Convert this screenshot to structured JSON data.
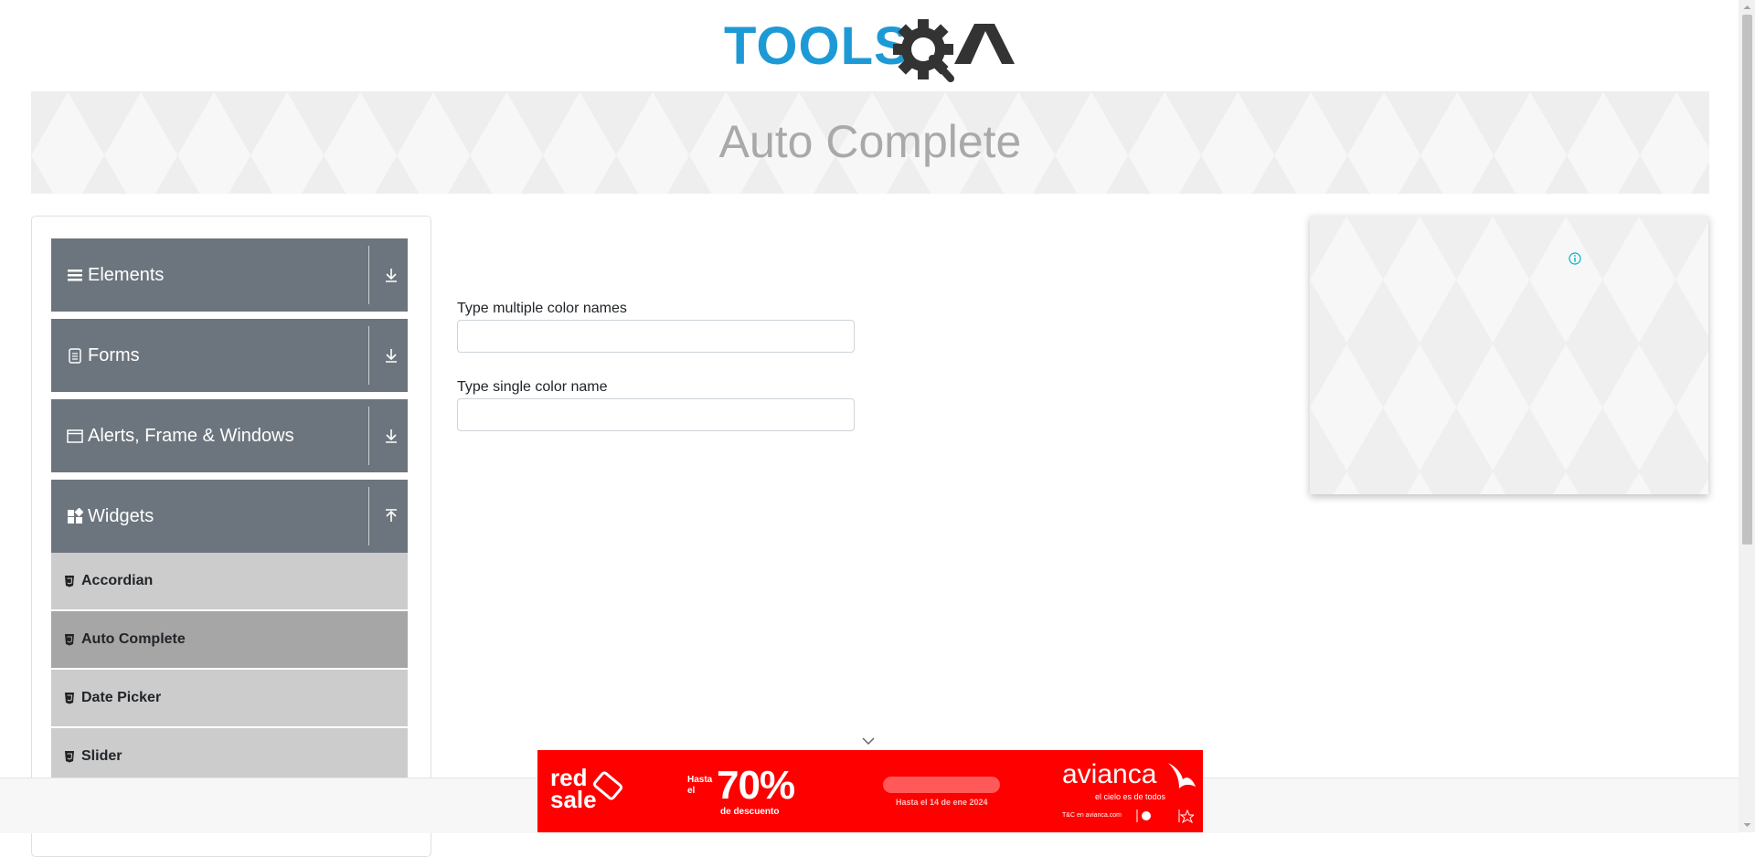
{
  "logo": {
    "text_tools": "TOOLS",
    "text_qa": "QA",
    "color_tools": "#1d9ad6",
    "color_qa": "#333333"
  },
  "header": {
    "title": "Auto Complete"
  },
  "sidebar": {
    "groups": [
      {
        "label": "Elements",
        "icon": "hamburger-icon",
        "state": "collapsed"
      },
      {
        "label": "Forms",
        "icon": "form-icon",
        "state": "collapsed"
      },
      {
        "label": "Alerts, Frame & Windows",
        "icon": "window-icon",
        "state": "collapsed"
      },
      {
        "label": "Widgets",
        "icon": "widgets-icon",
        "state": "expanded"
      }
    ],
    "widget_items": [
      {
        "label": "Accordian",
        "active": false
      },
      {
        "label": "Auto Complete",
        "active": true
      },
      {
        "label": "Date Picker",
        "active": false
      },
      {
        "label": "Slider",
        "active": false
      }
    ]
  },
  "form": {
    "multiple_label": "Type multiple color names",
    "multiple_value": "",
    "single_label": "Type single color name",
    "single_value": ""
  },
  "ad": {
    "brand_left": "red\nsale",
    "promo_prefix": "Hasta el",
    "promo_value": "70%",
    "promo_suffix": "de descuento",
    "deadline": "Hasta el 14 de ene 2024",
    "brand": "avianca",
    "tagline": "el cielo es de todos",
    "legal": "T&C en avianca.com",
    "background": "#ff0000"
  },
  "colors": {
    "sidebar_header": "#6c757d",
    "sub_item": "#cccccc",
    "sub_item_active": "#a6a6a6",
    "title": "#a9a9a9"
  }
}
